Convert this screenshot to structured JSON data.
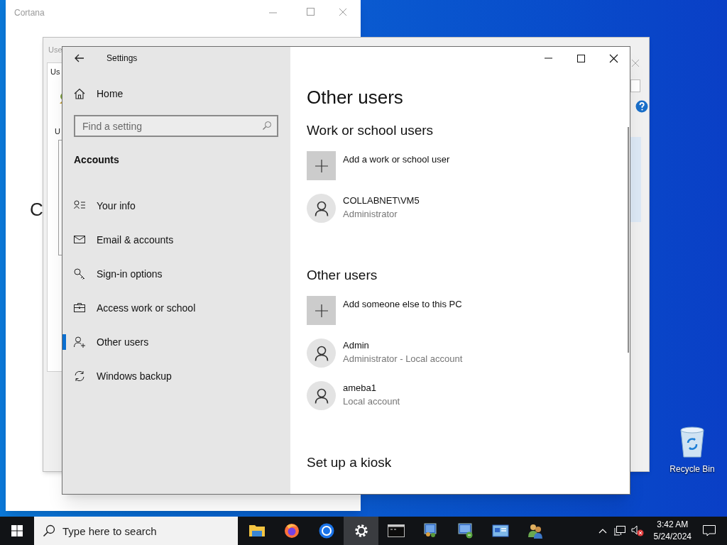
{
  "cortana_window": {
    "title": "Cortana",
    "body_text": "C"
  },
  "user_accounts_window": {
    "title": "Use",
    "tab": "Us",
    "label": "U"
  },
  "settings_window": {
    "title": "Settings",
    "sidebar": {
      "home": "Home",
      "search": {
        "placeholder": "Find a setting"
      },
      "section": "Accounts",
      "items": [
        {
          "kind": "info",
          "label": "Your info",
          "selected": false
        },
        {
          "kind": "mail",
          "label": "Email & accounts",
          "selected": false
        },
        {
          "kind": "key",
          "label": "Sign-in options",
          "selected": false
        },
        {
          "kind": "briefcase",
          "label": "Access work or school",
          "selected": false
        },
        {
          "kind": "person-add",
          "label": "Other users",
          "selected": true
        },
        {
          "kind": "sync",
          "label": "Windows backup",
          "selected": false
        }
      ]
    },
    "content": {
      "title": "Other users",
      "sections": [
        {
          "heading": "Work or school users",
          "items": [
            {
              "kind": "add",
              "name": "Add a work or school user"
            },
            {
              "kind": "user",
              "name": "COLLABNET\\VM5",
              "detail": "Administrator"
            }
          ]
        },
        {
          "heading": "Other users",
          "items": [
            {
              "kind": "add",
              "name": "Add someone else to this PC"
            },
            {
              "kind": "user",
              "name": "Admin",
              "detail": "Administrator - Local account"
            },
            {
              "kind": "user",
              "name": "ameba1",
              "detail": "Local account"
            }
          ]
        },
        {
          "heading": "Set up a kiosk"
        }
      ]
    }
  },
  "desktop": {
    "icons": [
      {
        "label": "Recycle Bin"
      }
    ]
  },
  "taskbar": {
    "search_placeholder": "Type here to search",
    "apps": [
      {
        "kind": "folder",
        "selected": false
      },
      {
        "kind": "firefox",
        "selected": false
      },
      {
        "kind": "chrome",
        "selected": false
      },
      {
        "kind": "settings",
        "selected": true
      },
      {
        "kind": "terminal",
        "selected": false
      },
      {
        "kind": "monitor-users",
        "selected": false
      },
      {
        "kind": "monitor-network",
        "selected": false
      },
      {
        "kind": "panel",
        "selected": false
      },
      {
        "kind": "users",
        "selected": false
      }
    ],
    "clock": {
      "time": "3:42 AM",
      "date": "5/24/2024"
    }
  }
}
